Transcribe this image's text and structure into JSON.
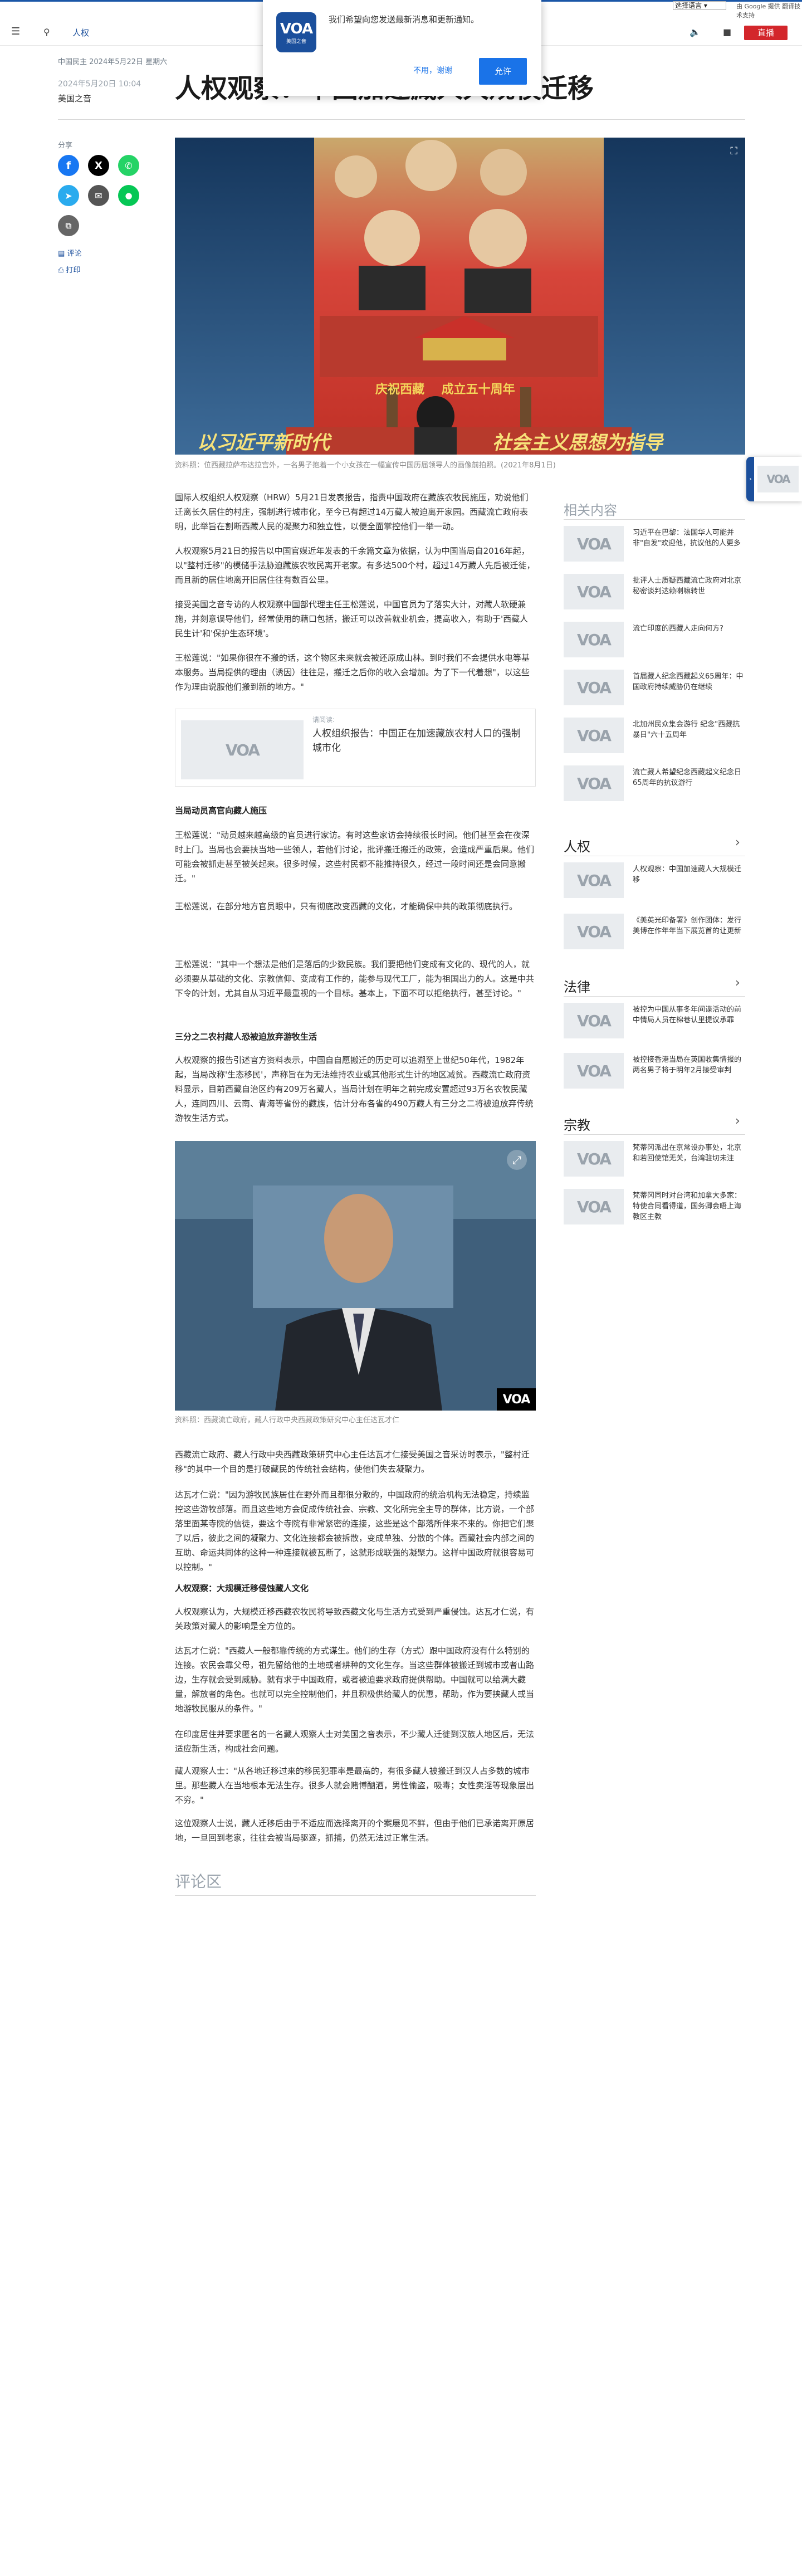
{
  "topbar": {
    "language_select": "选择语言",
    "google_powered": "由 Google 提供 翻译技术支持"
  },
  "header": {
    "section": "人权",
    "live": "直播"
  },
  "popup": {
    "message": "我们希望向您发送最新消息和更新通知。",
    "decline": "不用，谢谢",
    "allow": "允许",
    "logo": "VOA",
    "logo_sub": "美国之音"
  },
  "breadcrumb": "中国民主  2024年5月22日 星期六",
  "article": {
    "title": "人权观察：中国加速藏人大规模迁移",
    "date": "2024年5月20日 10:04",
    "author": "美国之音",
    "share_label": "分享",
    "comment_label": "评论",
    "print_label": "打印",
    "hero_caption": "资料照：位西藏拉萨布达拉宫外，一名男子抱着一个小女孩在一幅宣传中国历届领导人的画像前拍照。(2021年8月1日)",
    "hero_banner_left": "以习近平新时代",
    "hero_banner_right": "社会主义思想为指导",
    "hero_red_text": "庆祝西藏",
    "hero_red_text2": "成立五十周年",
    "video_caption": "资料照：西藏流亡政府，藏人行政中央西藏政策研究中心主任达瓦才仁",
    "video_logo": "VOA",
    "related_label": "请阅读:",
    "related_title": "人权组织报告：中国正在加速藏族农村人口的强制城市化",
    "paragraphs": [
      "国际人权组织人权观察（HRW）5月21日发表报告，指责中国政府在藏族农牧民施压，劝说他们迁离长久居住的村庄，强制进行城市化，至今已有超过14万藏人被迫离开家园。西藏流亡政府表明，此举旨在割断西藏人民的凝聚力和独立性，以便全面掌控他们一举一动。",
      "人权观察5月21日的报告以中国官媒近年发表的千余篇文章为依据，认为中国当局自2016年起，以\"整村迁移\"的模储手法胁迫藏族农牧民离开老家。有多达500个村，超过14万藏人先后被迁徙，而且新的居住地离开旧居住往有数百公里。",
      "接受美国之音专访的人权观察中国部代理主任王松莲说，中国官员为了落实大计，对藏人软硬兼施，并刻意误导他们，经常使用的藉口包括，搬迁可以改善就业机会，提高收入，有助于'西藏人民生计'和'保护生态环境'。",
      "王松莲说：\"如果你很在不搬的话，这个物区未来就会被还原成山林。到时我们不会提供水电等基本服务。当局提供的理由（诱因）往往是，搬迁之后你的收入会增加。为了下一代着想\"，以这些作为理由说服他们搬到新的地方。\"",
      "王松莲说，中国官员不惜使用各种方法，促成农牧民大规模迁移，包括利用官方宣传、表态、承诺，以及强迫搬迁户签约来实现目标。",
      "王松莲说：\"动员越来越高级的官员进行家访。有时这些家访会持续很长时间。他们甚至会在夜深时上门。当局也会要挟当地一些领人，若他们讨论，批评搬迁搬迁的政策，会造成严重后果。他们可能会被抓走甚至被关起来。很多时候，这些村民都不能推持很久，经过一段时间还是会同意搬迁。\"",
      "王松莲说，在部分地方官员眼中，只有彻底改变西藏的文化，才能确保中共的政策彻底执行。",
      "王松莲说：\"其中一个想法是他们是落后的少数民族。我们要把他们变成有文化的、现代的人，就必须要从基础的文化、宗教信仰、变成有工作的，能参与现代工厂，能为祖国出力的人。这是中共下令的计划，尤其自从习近平最重视的一个目标。基本上，下面不可以拒绝执行，甚至讨论。\"",
      "人权观察的报告引述官方资料表示，中国自自愿搬迁的历史可以追溯至上世纪50年代，1982年起，当局改称'生态移民'，声称旨在为无法维持农业或其他形式生计的地区减贫。西藏流亡政府资料显示，目前西藏自治区约有209万名藏人，当局计划在明年之前完成安置超过93万名农牧民藏人，连同四川、云南、青海等省份的藏族，估计分布各省的490万藏人有三分之二将被迫放弃传统游牧生活方式。",
      "西藏流亡政府、藏人行政中央西藏政策研究中心主任达瓦才仁接受美国之音采访时表示，\"整村迁移\"的其中一个目的是打破藏民的传统社会结构，使他们失去凝聚力。",
      "达瓦才仁说：\"因为游牧民族居住在野外而且都很分散的，中国政府的统治机构无法稳定，持续监控这些游牧部落。而且这些地方会促成传统社会、宗教、文化所完全主导的群体，比方说，一个部落里面某寺院的信徒，要这个寺院有非常紧密的连接，这些是这个部落所伴来不来的。你把它们聚了以后，彼此之间的凝聚力、文化连接都会被拆散，变成单独、分散的个体。西藏社会内部之间的互助、命运共同体的这种一种连接就被瓦断了，这就形成联强的凝聚力。这样中国政府就很容易可以控制。\"",
      "人权观察认为，大规模迁移西藏农牧民将导致西藏文化与生活方式受到严重侵蚀。达瓦才仁说，有关政策对藏人的影响是全方位的。",
      "达瓦才仁说：\"西藏人一般都靠传统的方式谋生。他们的生存（方式）跟中国政府没有什么特别的连接。农民会靠父母，祖先留给他的土地或者耕种的文化生存。当这些群体被搬迁到城市或者山路边，生存就会受到威胁。就有求于中国政府，或者被迫要求政府提供帮助。中国就可以给满大藏量，解放者的角色。也就可以完全控制他们，并且积极供给藏人的优惠，帮助，作为要挟藏人或当地游牧民服从的条件。\"",
      "在印度居住并要求匿名的一名藏人观察人士对美国之音表示，不少藏人迁徙到汉族人地区后，无法适应新生活，构成社会问题。",
      "藏人观察人士：\"从各地迁移过来的移民犯罪率是最高的，有很多藏人被搬迁到汉人占多数的城市里。那些藏人在当地根本无法生存。很多人就会赌博酗酒，男性偷盗，吸毒；女性卖淫等现象层出不穷。\"",
      "这位观察人士说，藏人迁移后由于不适应而选择离开的个案屡见不鲜，但由于他们已承诺离开原居地，一旦回到老家，往往会被当局驱逐，抓捕，仍然无法过正常生活。"
    ],
    "subheads": [
      "当局动员高官向藏人施压",
      "三分之二农村藏人恐被迫放弃游牧生活",
      "人权观察：大规模迁移侵蚀藏人文化"
    ],
    "comments_title": "评论区"
  },
  "sidebar": {
    "related_title": "相关内容",
    "related": [
      "习近平在巴黎：法国华人可能并非\"自发\"欢迎他，抗议他的人更多",
      "批评人士质疑西藏流亡政府对北京秘密谈判达赖喇嘛转世",
      "流亡印度的西藏人走向何方?",
      "首届藏人纪念西藏起义65周年：中国政府持续威胁仍在继续",
      "北加州民众集会游行 纪念\"西藏抗暴日\"六十五周年",
      "流亡藏人希望纪念西藏起义纪念日65周年的抗议游行"
    ],
    "human_rights_title": "人权",
    "human_rights": [
      "人权观察：中国加速藏人大规模迁移",
      "《美英光印备署》创作团体：发行美博在作年年当下展览首的让更新"
    ],
    "law_title": "法律",
    "law": [
      "被控为中国从事冬年间谍活动的前中情局人员在棉巷认里提议承罪",
      "被控接香港当局在英国收集情报的两名男子将于明年2月接受审判"
    ],
    "religion_title": "宗教",
    "religion": [
      "梵蒂冈派出在京常设办事处，北京和若回使馆无关，台湾驻切未注",
      "梵蒂冈同时对台湾和加拿大多家：特使合同看得道，国务卿会晤上海教区主教"
    ]
  },
  "colors": {
    "brand": "#1b4f9c",
    "live": "#d3262b",
    "allow": "#1a73e8",
    "facebook": "#1877f2",
    "x": "#000000",
    "whatsapp": "#25d366",
    "telegram": "#2aabee",
    "email": "#555555",
    "line": "#06c755"
  }
}
